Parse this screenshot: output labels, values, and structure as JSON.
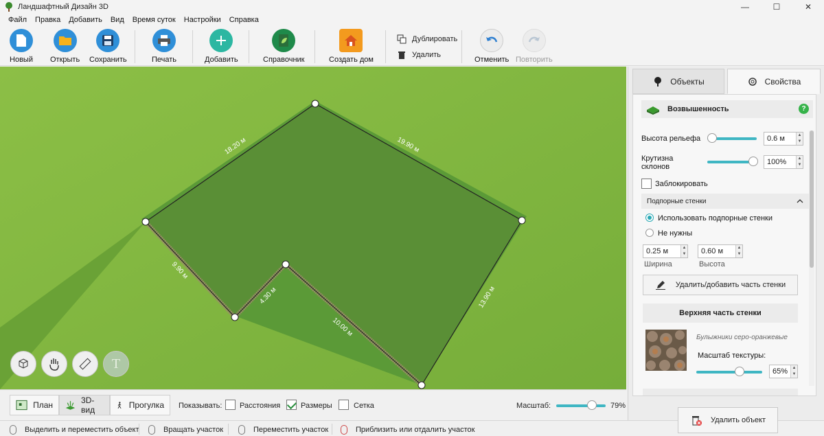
{
  "window": {
    "title": "Ландшафтный Дизайн 3D",
    "minimize": "—",
    "maximize": "☐",
    "close": "✕"
  },
  "menu": [
    "Файл",
    "Правка",
    "Добавить",
    "Вид",
    "Время суток",
    "Настройки",
    "Справка"
  ],
  "toolbar": {
    "new": "Новый",
    "open": "Открыть",
    "save": "Сохранить",
    "print": "Печать",
    "add": "Добавить",
    "reference": "Справочник",
    "create_house": "Создать дом",
    "duplicate": "Дублировать",
    "delete": "Удалить",
    "undo": "Отменить",
    "redo": "Повторить"
  },
  "scene": {
    "dimensions": [
      "18.20 м",
      "19.90 м",
      "13.90 м",
      "10.00 м",
      "4.30 м",
      "9.90 м"
    ],
    "text_tool": "T"
  },
  "viewbar": {
    "plan": "План",
    "view3d": "3D-вид",
    "walk": "Прогулка",
    "show_label": "Показывать:",
    "distances": "Расстояния",
    "sizes": "Размеры",
    "grid": "Сетка",
    "distances_checked": false,
    "sizes_checked": true,
    "grid_checked": false,
    "scale_label": "Масштаб:",
    "scale_value": "79%",
    "scale_fraction": 0.79
  },
  "status": [
    "Выделить и переместить объект",
    "Вращать участок",
    "Переместить участок",
    "Приблизить или отдалить участок"
  ],
  "panel": {
    "tab_objects": "Объекты",
    "tab_properties": "Свойства",
    "object_name": "Возвышенность",
    "help": "?",
    "relief_height_label": "Высота рельефа",
    "relief_height_value": "0.6 м",
    "relief_height_fraction": 0.05,
    "slope_label_1": "Крутизна",
    "slope_label_2": "склонов",
    "slope_value": "100%",
    "slope_fraction": 1.0,
    "lock_label": "Заблокировать",
    "lock_checked": false,
    "retaining_walls": "Подпорные стенки",
    "use_walls": "Использовать подпорные стенки",
    "no_walls": "Не нужны",
    "width_value": "0.25 м",
    "width_label": "Ширина",
    "height_value": "0.60 м",
    "height_label": "Высота",
    "edit_wall_button": "Удалить/добавить часть стенки",
    "top_part": "Верхняя часть стенки",
    "texture_name": "Булыжники серо-оранжевые",
    "texture_scale_label": "Масштаб текстуры:",
    "texture_scale_value": "65%",
    "texture_scale_fraction": 0.65,
    "delete_button": "Удалить объект"
  },
  "colors": {
    "accent": "#3fb6c3",
    "grass_dark": "#5a8f36",
    "grass_light": "#7fb23f",
    "help": "#36b34a"
  }
}
